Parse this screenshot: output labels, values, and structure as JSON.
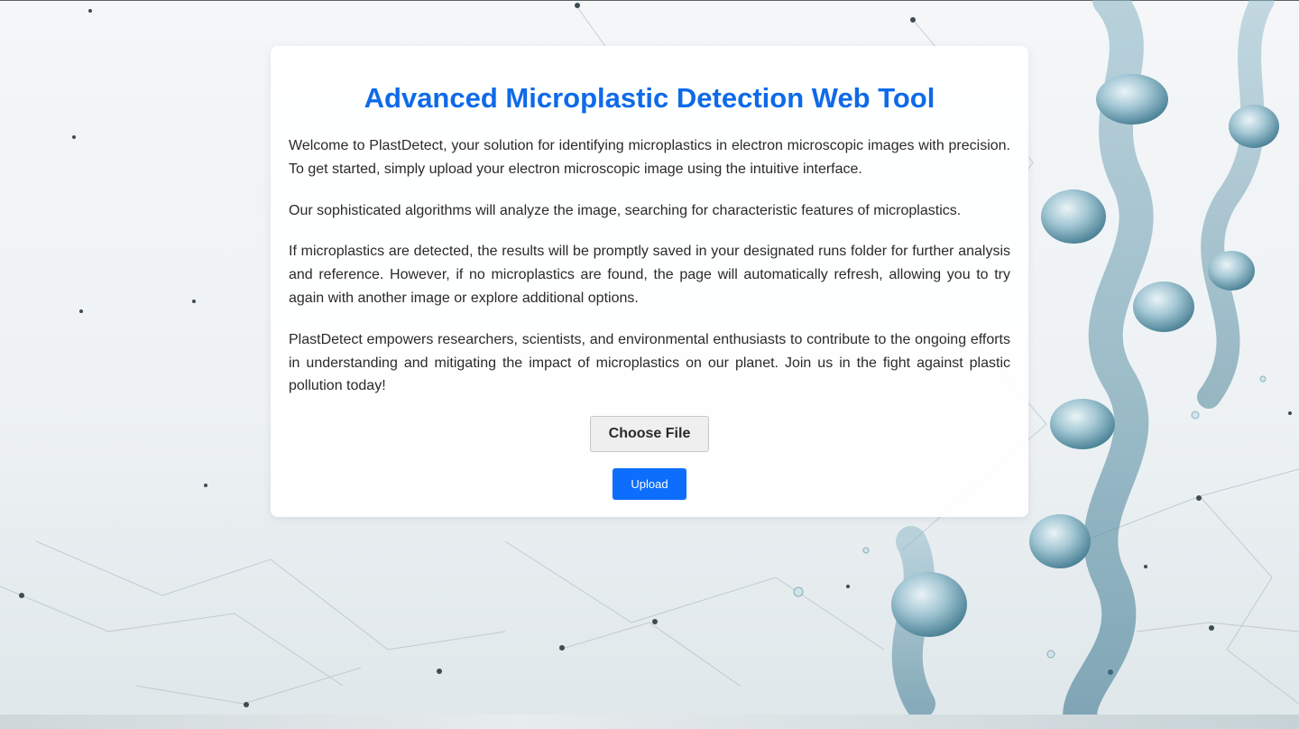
{
  "page": {
    "title": "Advanced Microplastic Detection Web Tool",
    "paragraphs": [
      "Welcome to PlastDetect, your solution for identifying microplastics in electron microscopic images with precision. To get started, simply upload your electron microscopic image using the intuitive interface.",
      "Our sophisticated algorithms will analyze the image, searching for characteristic features of microplastics.",
      "If microplastics are detected, the results will be promptly saved in your designated runs folder for further analysis and reference. However, if no microplastics are found, the page will automatically refresh, allowing you to try again with another image or explore additional options.",
      "PlastDetect empowers researchers, scientists, and environmental enthusiasts to contribute to the ongoing efforts in understanding and mitigating the impact of microplastics on our planet. Join us in the fight against plastic pollution today!"
    ]
  },
  "form": {
    "choose_file_label": "Choose File",
    "upload_label": "Upload"
  },
  "colors": {
    "title": "#0e6ae8",
    "upload_button": "#0d6efd",
    "background_art": "#4e8aa0"
  },
  "icons": {
    "background": "molecular-network-illustration"
  }
}
